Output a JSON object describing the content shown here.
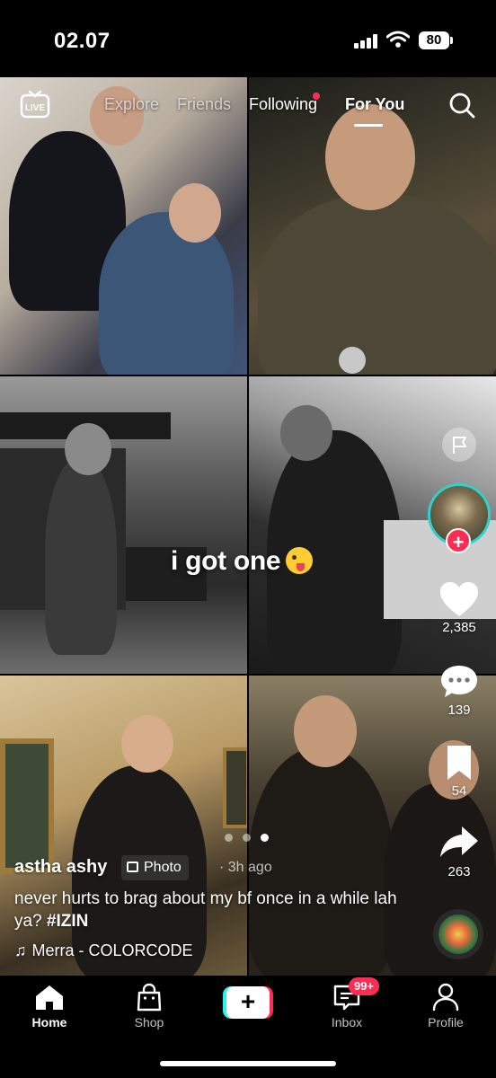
{
  "status_bar": {
    "time": "02.07",
    "battery": "80"
  },
  "top_nav": {
    "live_label": "LIVE",
    "tabs": [
      {
        "label": "Explore"
      },
      {
        "label": "Friends"
      },
      {
        "label": "Following",
        "has_dot": true
      },
      {
        "label": "For You",
        "active": true
      }
    ]
  },
  "post": {
    "overlay_text": "i got one",
    "author": "astha ashy",
    "type_badge": "Photo",
    "time_ago": "· 3h ago",
    "caption": "never hurts to brag about my bf once in a while lah ya?",
    "hashtag": "#IZIN",
    "music": "Merra - COLORCODE",
    "carousel": {
      "count": 3,
      "active_index": 2
    }
  },
  "actions": {
    "likes": "2,385",
    "comments": "139",
    "saves": "54",
    "shares": "263"
  },
  "bottom_nav": {
    "home": "Home",
    "shop": "Shop",
    "inbox": "Inbox",
    "inbox_badge": "99+",
    "profile": "Profile"
  },
  "colors": {
    "accent_red": "#fe2c55",
    "accent_cyan": "#25f4ee",
    "avatar_ring": "#31d0c9"
  }
}
